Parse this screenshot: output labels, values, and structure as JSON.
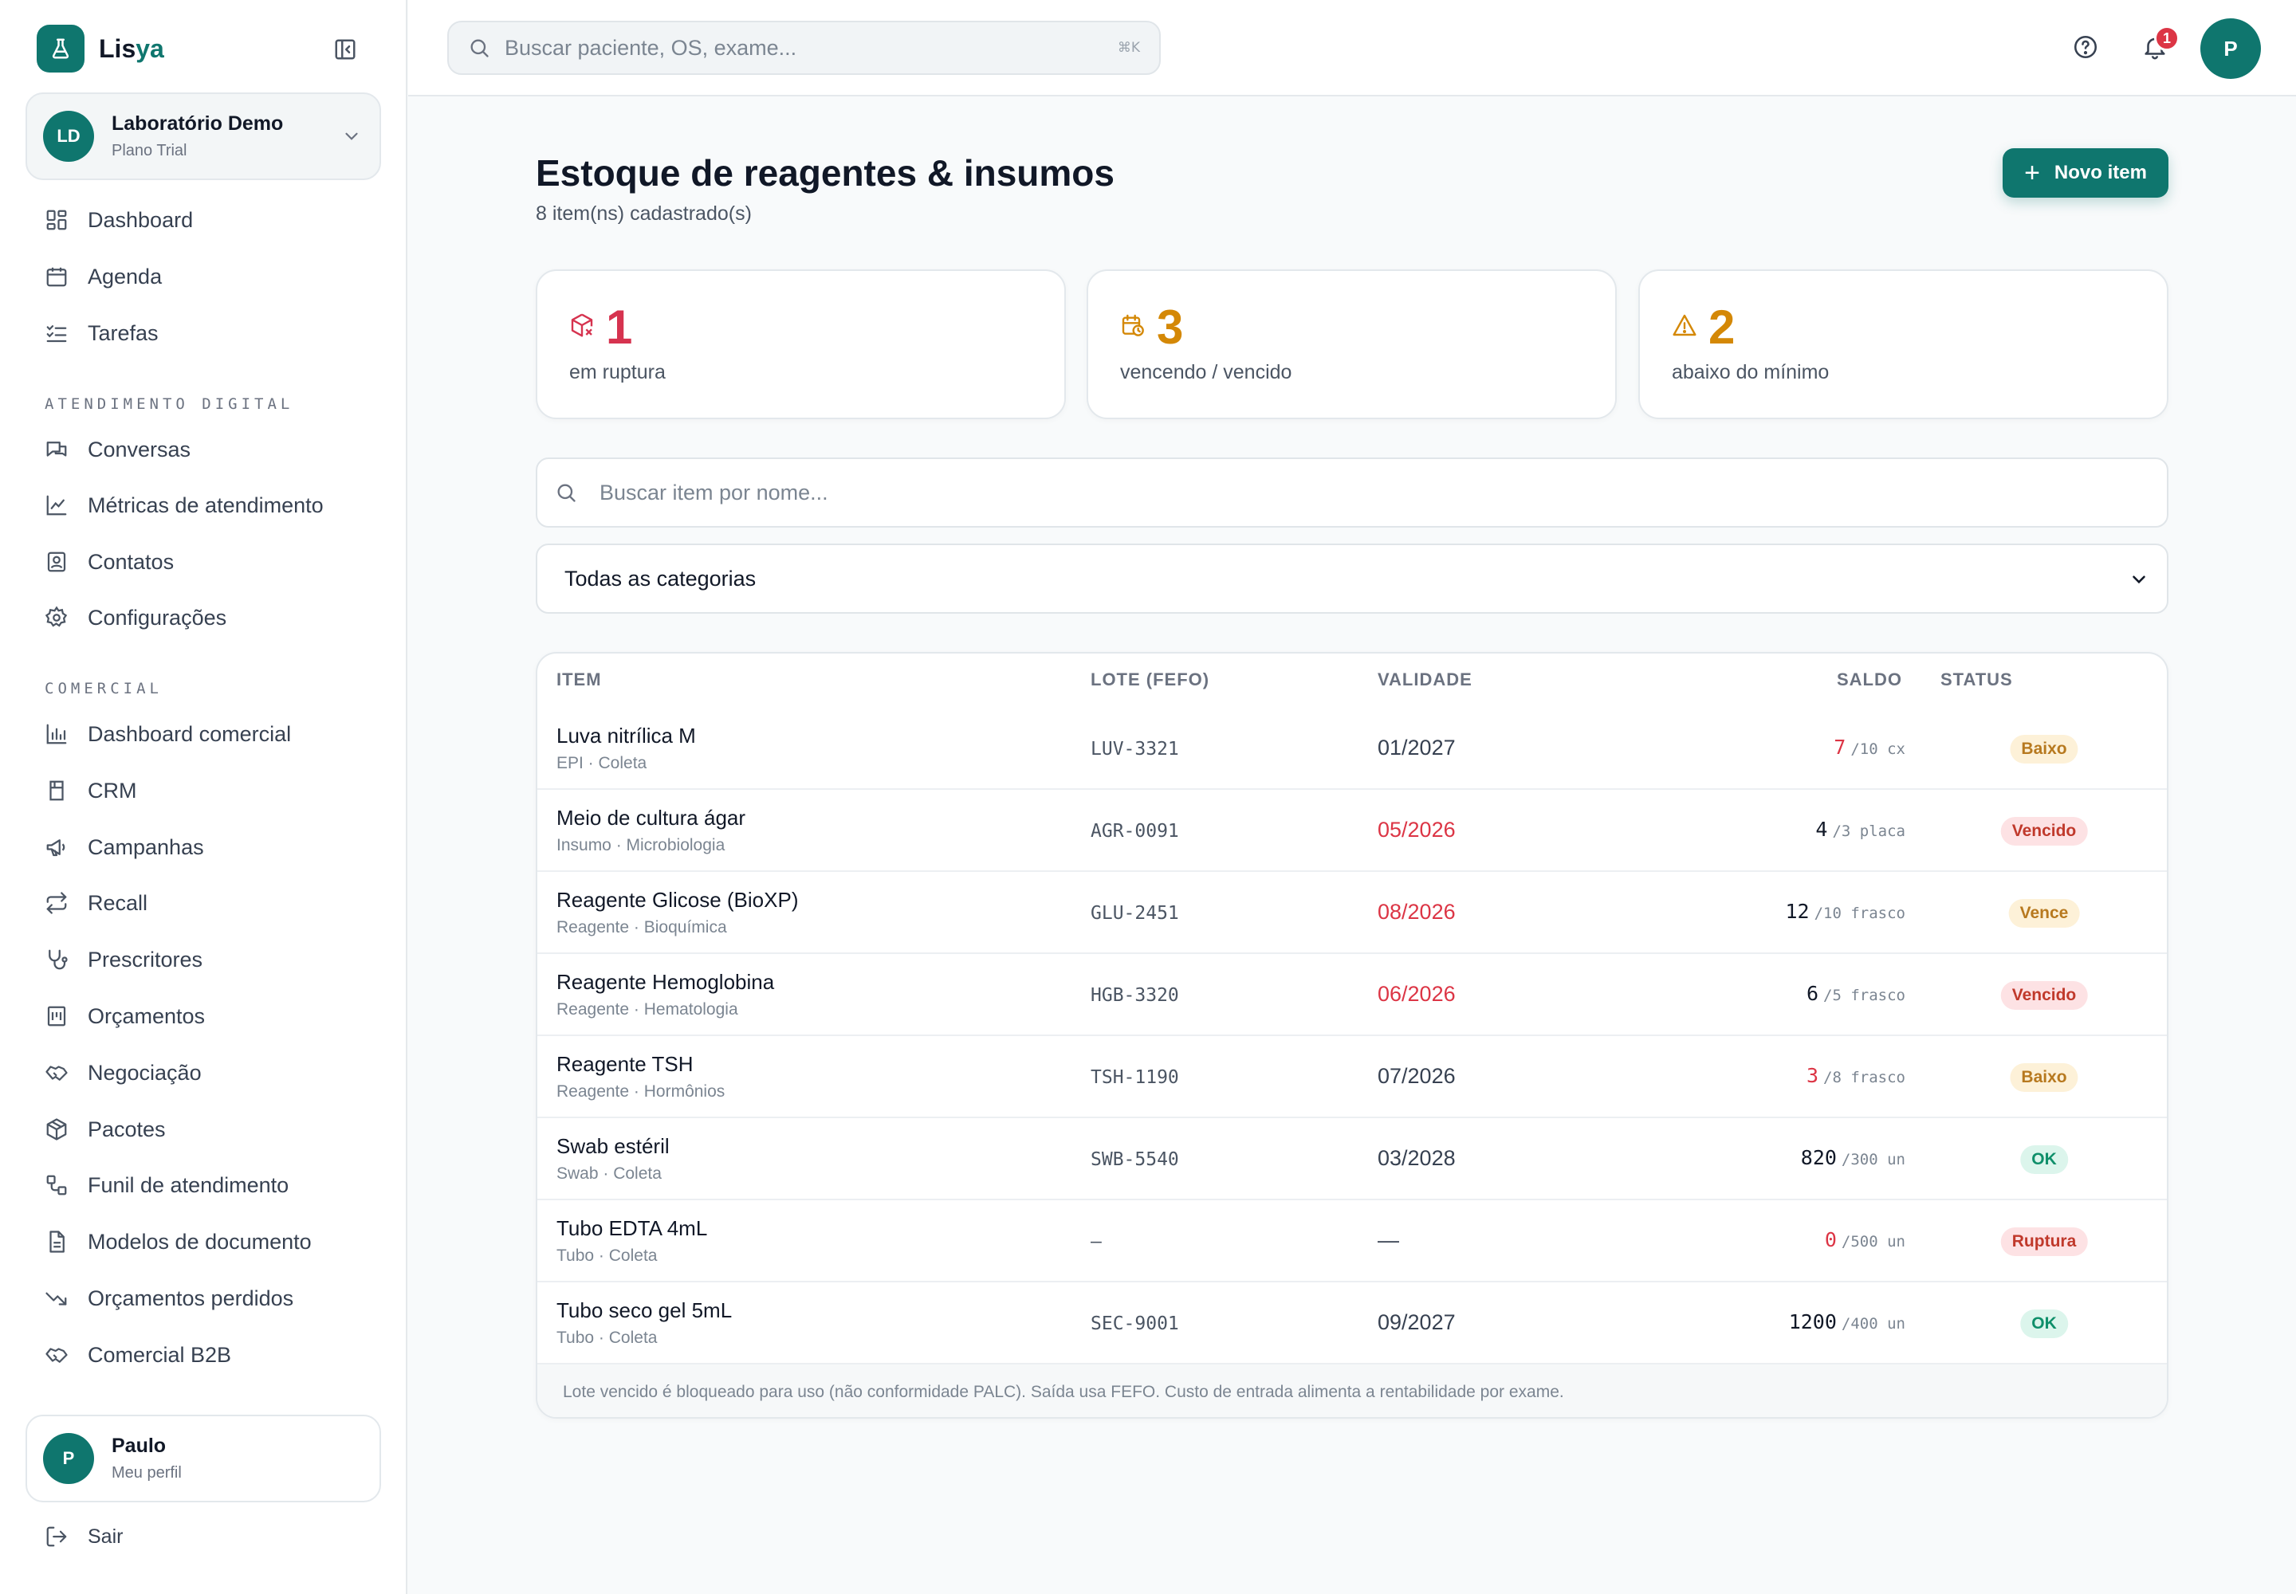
{
  "app": {
    "name_part1": "Lis",
    "name_part2": "ya"
  },
  "org": {
    "initials": "LD",
    "name": "Laboratório Demo",
    "plan": "Plano Trial"
  },
  "nav": {
    "main": [
      {
        "label": "Dashboard",
        "icon": "dashboard-icon"
      },
      {
        "label": "Agenda",
        "icon": "calendar-icon"
      },
      {
        "label": "Tarefas",
        "icon": "checklist-icon"
      }
    ],
    "section1": "Atendimento digital",
    "digital": [
      {
        "label": "Conversas",
        "icon": "chat-icon"
      },
      {
        "label": "Métricas de atendimento",
        "icon": "chart-line-icon"
      },
      {
        "label": "Contatos",
        "icon": "contact-icon"
      },
      {
        "label": "Configurações",
        "icon": "gear-icon"
      }
    ],
    "section2": "Comercial",
    "comercial": [
      {
        "label": "Dashboard comercial",
        "icon": "bar-chart-icon"
      },
      {
        "label": "CRM",
        "icon": "crm-icon"
      },
      {
        "label": "Campanhas",
        "icon": "megaphone-icon"
      },
      {
        "label": "Recall",
        "icon": "repeat-icon"
      },
      {
        "label": "Prescritores",
        "icon": "stethoscope-icon"
      },
      {
        "label": "Orçamentos",
        "icon": "receipt-icon"
      },
      {
        "label": "Negociação",
        "icon": "handshake-icon"
      },
      {
        "label": "Pacotes",
        "icon": "package-icon"
      },
      {
        "label": "Funil de atendimento",
        "icon": "workflow-icon"
      },
      {
        "label": "Modelos de documento",
        "icon": "document-icon"
      },
      {
        "label": "Orçamentos perdidos",
        "icon": "trending-down-icon"
      },
      {
        "label": "Comercial B2B",
        "icon": "handshake-b2b-icon"
      }
    ]
  },
  "profile": {
    "initial": "P",
    "name": "Paulo",
    "sub": "Meu perfil"
  },
  "logout_label": "Sair",
  "topbar": {
    "search_placeholder": "Buscar paciente, OS, exame...",
    "shortcut": "⌘K",
    "notif_count": "1",
    "user_initial": "P"
  },
  "page": {
    "title": "Estoque de reagentes & insumos",
    "subtitle": "8 item(ns) cadastrado(s)",
    "new_button": "Novo item"
  },
  "stats": [
    {
      "value": "1",
      "label": "em ruptura",
      "color": "#d6334f",
      "icon": "package-x-icon"
    },
    {
      "value": "3",
      "label": "vencendo / vencido",
      "color": "#d48806",
      "icon": "calendar-clock-icon"
    },
    {
      "value": "2",
      "label": "abaixo do mínimo",
      "color": "#d48806",
      "icon": "warning-icon"
    }
  ],
  "filters": {
    "search_placeholder": "Buscar item por nome...",
    "category": "Todas as categorias"
  },
  "table": {
    "headers": {
      "item": "Item",
      "lote": "Lote (FEFO)",
      "validade": "Validade",
      "saldo": "Saldo",
      "status": "Status"
    },
    "rows": [
      {
        "name": "Luva nitrílica M",
        "meta": "EPI · Coleta",
        "lote": "LUV-3321",
        "validade": "01/2027",
        "val_red": false,
        "qty": "7",
        "qty_red": true,
        "unit": "/10 cx",
        "status": "Baixo",
        "status_type": "baixo"
      },
      {
        "name": "Meio de cultura ágar",
        "meta": "Insumo · Microbiologia",
        "lote": "AGR-0091",
        "validade": "05/2026",
        "val_red": true,
        "qty": "4",
        "qty_red": false,
        "unit": "/3 placa",
        "status": "Vencido",
        "status_type": "vencido"
      },
      {
        "name": "Reagente Glicose (BioXP)",
        "meta": "Reagente · Bioquímica",
        "lote": "GLU-2451",
        "validade": "08/2026",
        "val_red": true,
        "qty": "12",
        "qty_red": false,
        "unit": "/10 frasco",
        "status": "Vence",
        "status_type": "vence"
      },
      {
        "name": "Reagente Hemoglobina",
        "meta": "Reagente · Hematologia",
        "lote": "HGB-3320",
        "validade": "06/2026",
        "val_red": true,
        "qty": "6",
        "qty_red": false,
        "unit": "/5 frasco",
        "status": "Vencido",
        "status_type": "vencido"
      },
      {
        "name": "Reagente TSH",
        "meta": "Reagente · Hormônios",
        "lote": "TSH-1190",
        "validade": "07/2026",
        "val_red": false,
        "qty": "3",
        "qty_red": true,
        "unit": "/8 frasco",
        "status": "Baixo",
        "status_type": "baixo"
      },
      {
        "name": "Swab estéril",
        "meta": "Swab · Coleta",
        "lote": "SWB-5540",
        "validade": "03/2028",
        "val_red": false,
        "qty": "820",
        "qty_red": false,
        "unit": "/300 un",
        "status": "OK",
        "status_type": "ok"
      },
      {
        "name": "Tubo EDTA 4mL",
        "meta": "Tubo · Coleta",
        "lote": "—",
        "validade": "—",
        "val_red": false,
        "qty": "0",
        "qty_red": true,
        "unit": "/500 un",
        "status": "Ruptura",
        "status_type": "ruptura"
      },
      {
        "name": "Tubo seco gel 5mL",
        "meta": "Tubo · Coleta",
        "lote": "SEC-9001",
        "validade": "09/2027",
        "val_red": false,
        "qty": "1200",
        "qty_red": false,
        "unit": "/400 un",
        "status": "OK",
        "status_type": "ok"
      }
    ],
    "footer": "Lote vencido é bloqueado para uso (não conformidade PALC). Saída usa FEFO. Custo de entrada alimenta a rentabilidade por exame."
  }
}
